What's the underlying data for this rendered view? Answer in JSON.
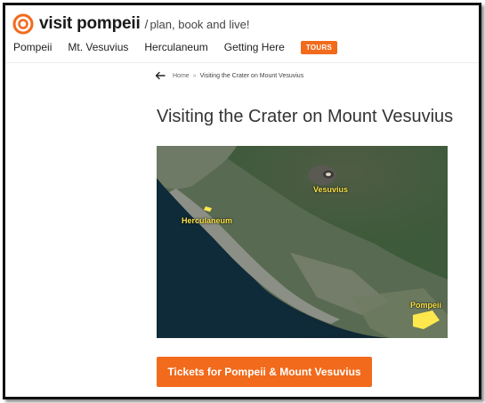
{
  "site": {
    "brand": "visit pompeii",
    "separator": "/",
    "tagline": "plan, book and live!",
    "accent_color": "#f26a1b"
  },
  "nav": {
    "items": [
      "Pompeii",
      "Mt. Vesuvius",
      "Herculaneum",
      "Getting Here"
    ],
    "tours_label": "TOURS"
  },
  "breadcrumb": {
    "back_icon": "arrow-left-icon",
    "home": "Home",
    "separator": "»",
    "current": "Visiting the Crater on Mount Vesuvius"
  },
  "page": {
    "title": "Visiting the Crater on Mount Vesuvius"
  },
  "map": {
    "labels": {
      "vesuvius": "Vesuvius",
      "herculaneum": "Herculaneum",
      "pompeii": "Pompeii"
    },
    "label_color": "#ffe84d"
  },
  "cta": {
    "label": "Tickets for Pompeii & Mount Vesuvius"
  }
}
